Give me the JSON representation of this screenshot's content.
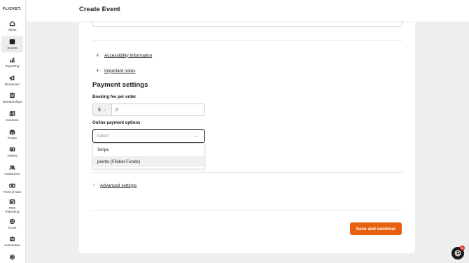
{
  "brand": {
    "logo_text": "FLICKET."
  },
  "sidebar": {
    "items": [
      {
        "label": "Home",
        "icon": "home-icon"
      },
      {
        "label": "Events",
        "icon": "calendar-icon",
        "active": true
      },
      {
        "label": "Reporting",
        "icon": "chart-icon"
      },
      {
        "label": "Broadcast",
        "icon": "megaphone-icon"
      },
      {
        "label": "Memberships",
        "icon": "membership-card-icon"
      },
      {
        "label": "Seasons",
        "icon": "map-icon"
      },
      {
        "label": "Points",
        "icon": "gift-icon"
      },
      {
        "label": "Orders",
        "icon": "ticket-icon"
      },
      {
        "label": "Customers",
        "icon": "users-icon"
      },
      {
        "label": "Point of sale",
        "icon": "cash-icon"
      },
      {
        "label": "POS Reporting",
        "icon": "receipt-icon"
      },
      {
        "label": "Scout",
        "icon": "scout-icon"
      },
      {
        "label": "Automation",
        "icon": "robot-icon"
      },
      {
        "label": "",
        "icon": "settings-icon"
      }
    ]
  },
  "header": {
    "title": "Create Event"
  },
  "form": {
    "accessibility_link": "Accessibility information",
    "important_notes_link": "Important notes",
    "payment_section_title": "Payment settings",
    "booking_fee": {
      "label": "Booking fee per order",
      "currency_symbol": "$",
      "value": "0"
    },
    "online_payment": {
      "label": "Online payment options",
      "placeholder": "Select",
      "options": [
        "Stripe",
        "points (Flicket Funds)"
      ],
      "hovered_option": "points (Flicket Funds)"
    },
    "advanced_settings_link": "Advanced settings",
    "save_button": "Save and continue"
  },
  "help_widget": {
    "icon": "lifebuoy-icon",
    "badge_count": "1"
  },
  "colors": {
    "accent": "#e8620e",
    "badge": "#e0302b",
    "active_nav_bg": "#ececec"
  }
}
